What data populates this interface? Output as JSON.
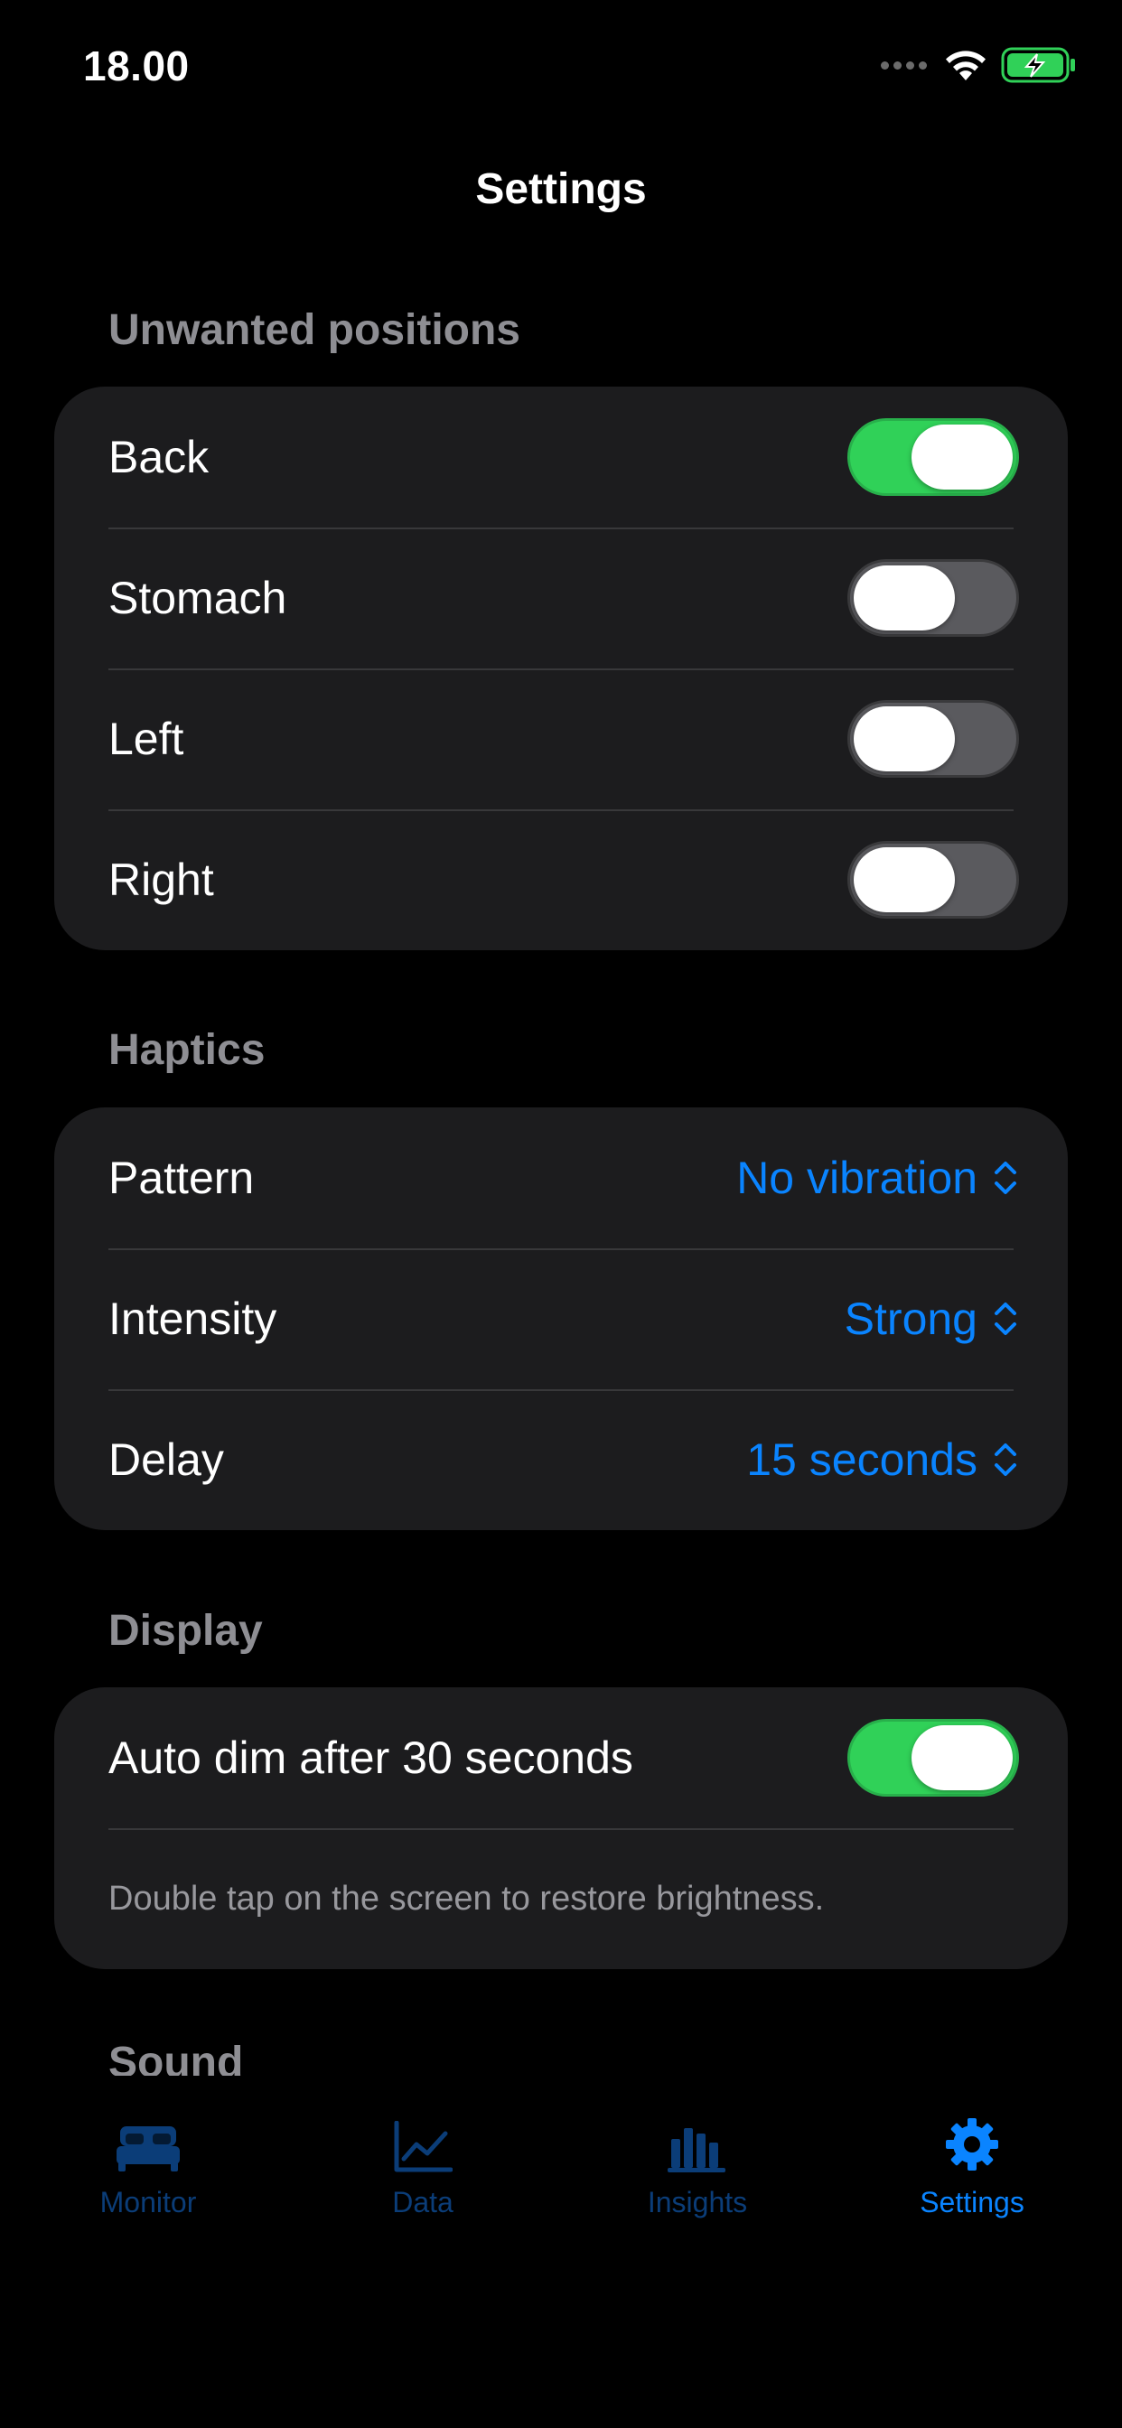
{
  "status_bar": {
    "time": "18.00"
  },
  "nav": {
    "title": "Settings"
  },
  "sections": {
    "unwanted_positions": {
      "header": "Unwanted positions",
      "rows": [
        {
          "label": "Back",
          "on": true
        },
        {
          "label": "Stomach",
          "on": false
        },
        {
          "label": "Left",
          "on": false
        },
        {
          "label": "Right",
          "on": false
        }
      ]
    },
    "haptics": {
      "header": "Haptics",
      "rows": [
        {
          "label": "Pattern",
          "value": "No vibration"
        },
        {
          "label": "Intensity",
          "value": "Strong"
        },
        {
          "label": "Delay",
          "value": "15 seconds"
        }
      ]
    },
    "display": {
      "header": "Display",
      "toggle_label": "Auto dim after 30 seconds",
      "toggle_on": true,
      "footnote": "Double tap on the screen to restore brightness."
    },
    "sound": {
      "header": "Sound"
    }
  },
  "tab_bar": {
    "tabs": [
      {
        "label": "Monitor",
        "icon": "bed-icon",
        "active": false
      },
      {
        "label": "Data",
        "icon": "line-chart-icon",
        "active": false
      },
      {
        "label": "Insights",
        "icon": "bar-chart-icon",
        "active": false
      },
      {
        "label": "Settings",
        "icon": "gear-icon",
        "active": true
      }
    ]
  },
  "colors": {
    "background": "#000000",
    "group_background": "#1c1c1e",
    "toggle_on": "#30d158",
    "toggle_off": "#5a5a5e",
    "accent": "#0a84ff",
    "tab_inactive": "#0b3d78",
    "section_header": "#8e8e93"
  }
}
